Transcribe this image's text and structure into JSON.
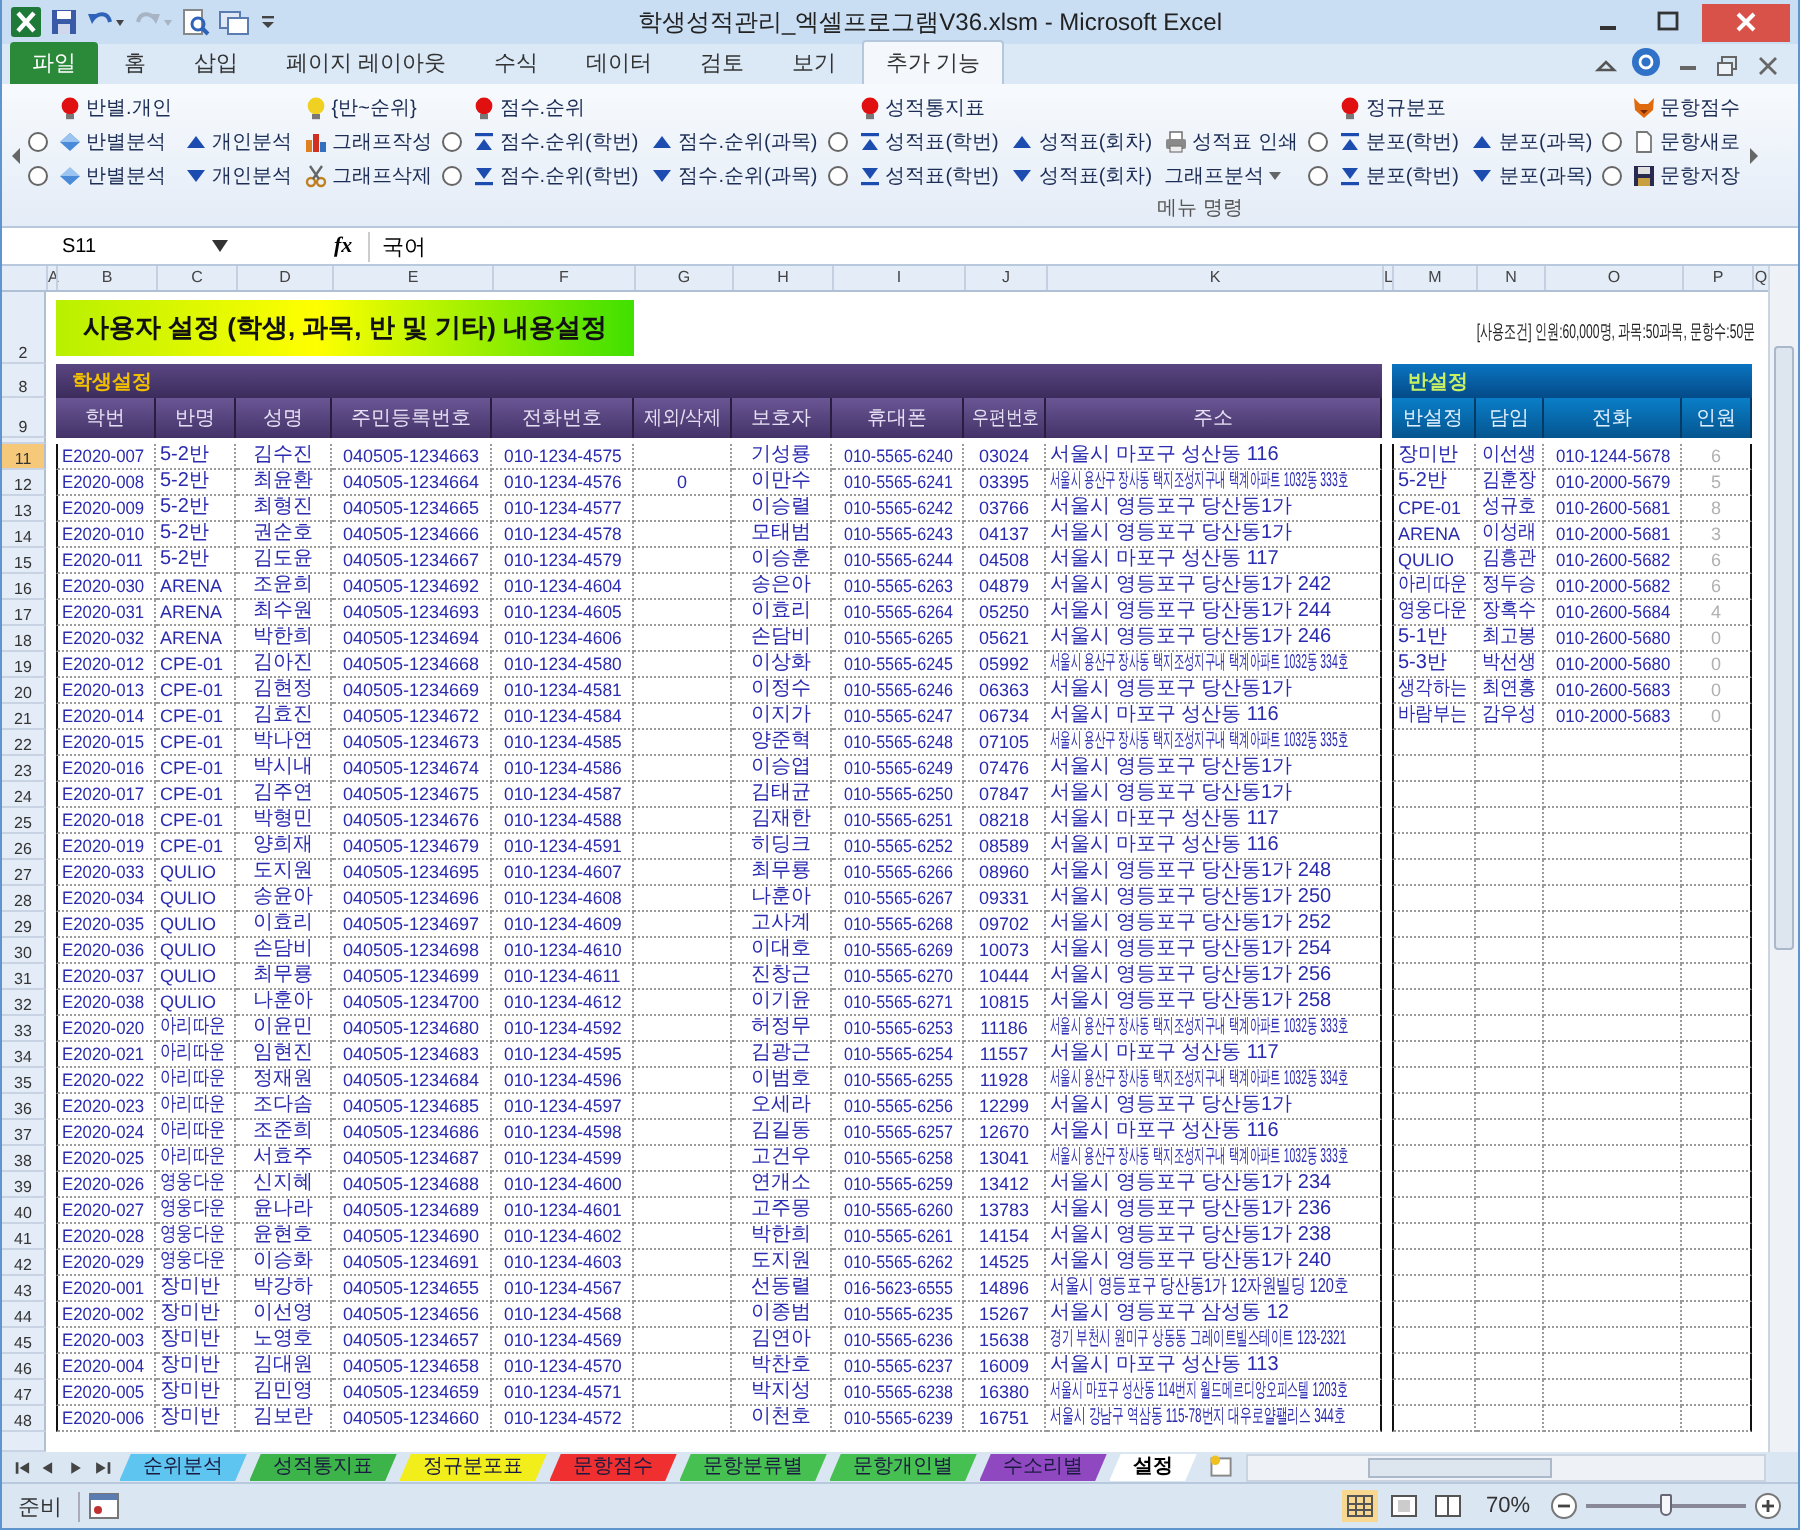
{
  "window": {
    "title": "학생성적관리_엑셀프로그램V36.xlsm  -  Microsoft Excel"
  },
  "menu_tabs": [
    {
      "label": "파일",
      "kind": "file",
      "selected": false
    },
    {
      "label": "홈",
      "selected": false
    },
    {
      "label": "삽입",
      "selected": false
    },
    {
      "label": "페이지 레이아웃",
      "selected": false
    },
    {
      "label": "수식",
      "selected": false
    },
    {
      "label": "데이터",
      "selected": false
    },
    {
      "label": "검토",
      "selected": false
    },
    {
      "label": "보기",
      "selected": false
    },
    {
      "label": "추가 기능",
      "selected": true
    }
  ],
  "ribbon": {
    "columns": [
      {
        "items": [
          {
            "kind": "radio",
            "checked": false
          },
          {
            "kind": "radio",
            "checked": false
          }
        ]
      },
      {
        "header": {
          "label": "반별.개인",
          "kind": "bulb-red"
        },
        "items": [
          {
            "label": "반별분석",
            "kind": "diamond-up"
          },
          {
            "label": "반별분석",
            "kind": "diamond-down"
          }
        ]
      },
      {
        "items": [
          {
            "label": "개인분석",
            "kind": "up"
          },
          {
            "label": "개인분석",
            "kind": "down"
          }
        ]
      },
      {
        "header": {
          "label": "{반~순위}",
          "kind": "bulb-yellow"
        },
        "items": [
          {
            "label": "그래프작성",
            "kind": "chart"
          },
          {
            "label": "그래프삭제",
            "kind": "scissors"
          }
        ]
      },
      {
        "items": [
          {
            "kind": "radio",
            "checked": false
          },
          {
            "kind": "radio",
            "checked": false
          }
        ]
      },
      {
        "header": {
          "label": "점수.순위",
          "kind": "bulb-red"
        },
        "items": [
          {
            "label": "점수.순위(학번)",
            "kind": "top"
          },
          {
            "label": "점수.순위(학번)",
            "kind": "bottom"
          }
        ]
      },
      {
        "items": [
          {
            "label": "점수.순위(과목)",
            "kind": "up"
          },
          {
            "label": "점수.순위(과목)",
            "kind": "down"
          }
        ]
      },
      {
        "items": [
          {
            "kind": "radio",
            "checked": false
          },
          {
            "kind": "radio",
            "checked": false
          }
        ]
      },
      {
        "header": {
          "label": "성적통지표",
          "kind": "bulb-red"
        },
        "items": [
          {
            "label": "성적표(학번)",
            "kind": "top"
          },
          {
            "label": "성적표(학번)",
            "kind": "bottom"
          }
        ]
      },
      {
        "items": [
          {
            "label": "성적표(회차)",
            "kind": "up"
          },
          {
            "label": "성적표(회차)",
            "kind": "down"
          }
        ]
      },
      {
        "items": [
          {
            "label": "성적표 인쇄",
            "kind": "printer"
          },
          {
            "label": "그래프분석",
            "kind": "dropdown"
          }
        ]
      },
      {
        "items": [
          {
            "kind": "radio",
            "checked": false
          },
          {
            "kind": "radio",
            "checked": false
          }
        ]
      },
      {
        "header": {
          "label": "정규분포",
          "kind": "bulb-red"
        },
        "items": [
          {
            "label": "분포(학번)",
            "kind": "top"
          },
          {
            "label": "분포(학번)",
            "kind": "bottom"
          }
        ]
      },
      {
        "items": [
          {
            "label": "분포(과목)",
            "kind": "up"
          },
          {
            "label": "분포(과목)",
            "kind": "down"
          }
        ]
      },
      {
        "items": [
          {
            "kind": "radio",
            "checked": false
          },
          {
            "kind": "radio",
            "checked": false
          }
        ]
      },
      {
        "header": {
          "label": "문항점수",
          "kind": "fox"
        },
        "items": [
          {
            "label": "문항새로",
            "kind": "doc"
          },
          {
            "label": "문항저장",
            "kind": "disk"
          }
        ]
      }
    ],
    "group_label": "메뉴 명령"
  },
  "formula_bar": {
    "name_box": "S11",
    "fx_label": "fx",
    "value": "국어"
  },
  "column_letters": [
    "A",
    "B",
    "C",
    "D",
    "E",
    "F",
    "G",
    "H",
    "I",
    "J",
    "K",
    "L",
    "M",
    "N",
    "O",
    "P",
    "Q"
  ],
  "sheet": {
    "banner_row": "2",
    "banner": "사용자 설정 (학생, 과목, 반 및 기타) 내용설정",
    "note": "[사용조건] 인원:60,000명, 과목:50과목, 문항수:50문",
    "section_row": "8",
    "student_section": "학생설정",
    "class_section": "반설정",
    "header_row": "9",
    "student_columns": [
      "학번",
      "반명",
      "성명",
      "주민등록번호",
      "전화번호",
      "제외/삭제",
      "보호자",
      "휴대폰",
      "우편번호",
      "주소"
    ],
    "class_columns": [
      "반설정",
      "담임",
      "전화",
      "인원"
    ],
    "rows": [
      {
        "num": "11",
        "selected": true,
        "student": {
          "id": "E2020-007",
          "cls": "5-2반",
          "name": "김수진",
          "rrn": "040505-1234663",
          "phone": "010-1234-4575",
          "guardian": "기성룡",
          "mobile": "010-5565-6240",
          "zip": "03024",
          "addr": "서울시 마포구 성산동 116"
        },
        "class_info": {
          "cls": "장미반",
          "teacher": "이선생",
          "phone": "010-1244-5678",
          "count": "6"
        }
      },
      {
        "num": "12",
        "selected": false,
        "student": {
          "id": "E2020-008",
          "cls": "5-2반",
          "name": "최윤환",
          "rrn": "040505-1234664",
          "phone": "010-1234-4576",
          "excl": "0",
          "guardian": "이만수",
          "mobile": "010-5565-6241",
          "zip": "03395",
          "addr": "서울시 용산구 장사동 택지조성지구내 택계아파트 1032동 333호"
        },
        "class_info": {
          "cls": "5-2반",
          "teacher": "김훈장",
          "phone": "010-2000-5679",
          "count": "5"
        }
      },
      {
        "num": "13",
        "selected": false,
        "student": {
          "id": "E2020-009",
          "cls": "5-2반",
          "name": "최형진",
          "rrn": "040505-1234665",
          "phone": "010-1234-4577",
          "guardian": "이승렬",
          "mobile": "010-5565-6242",
          "zip": "03766",
          "addr": "서울시 영등포구 당산동1가"
        },
        "class_info": {
          "cls": "CPE-01",
          "teacher": "성규호",
          "phone": "010-2600-5681",
          "count": "8"
        }
      },
      {
        "num": "14",
        "selected": false,
        "student": {
          "id": "E2020-010",
          "cls": "5-2반",
          "name": "권순호",
          "rrn": "040505-1234666",
          "phone": "010-1234-4578",
          "guardian": "모태범",
          "mobile": "010-5565-6243",
          "zip": "04137",
          "addr": "서울시 영등포구 당산동1가"
        },
        "class_info": {
          "cls": "ARENA",
          "teacher": "이성래",
          "phone": "010-2000-5681",
          "count": "3"
        }
      },
      {
        "num": "15",
        "selected": false,
        "student": {
          "id": "E2020-011",
          "cls": "5-2반",
          "name": "김도윤",
          "rrn": "040505-1234667",
          "phone": "010-1234-4579",
          "guardian": "이승훈",
          "mobile": "010-5565-6244",
          "zip": "04508",
          "addr": "서울시 마포구 성산동 117"
        },
        "class_info": {
          "cls": "QULIO",
          "teacher": "김흥관",
          "phone": "010-2600-5682",
          "count": "6"
        }
      },
      {
        "num": "16",
        "selected": false,
        "student": {
          "id": "E2020-030",
          "cls": "ARENA",
          "name": "조윤희",
          "rrn": "040505-1234692",
          "phone": "010-1234-4604",
          "guardian": "송은아",
          "mobile": "010-5565-6263",
          "zip": "04879",
          "addr": "서울시 영등포구 당산동1가 242"
        },
        "class_info": {
          "cls": "아리따운",
          "teacher": "정두승",
          "phone": "010-2000-5682",
          "count": "6"
        }
      },
      {
        "num": "17",
        "selected": false,
        "student": {
          "id": "E2020-031",
          "cls": "ARENA",
          "name": "최수원",
          "rrn": "040505-1234693",
          "phone": "010-1234-4605",
          "guardian": "이효리",
          "mobile": "010-5565-6264",
          "zip": "05250",
          "addr": "서울시 영등포구 당산동1가 244"
        },
        "class_info": {
          "cls": "영웅다운",
          "teacher": "장혹수",
          "phone": "010-2600-5684",
          "count": "4"
        }
      },
      {
        "num": "18",
        "selected": false,
        "student": {
          "id": "E2020-032",
          "cls": "ARENA",
          "name": "박한희",
          "rrn": "040505-1234694",
          "phone": "010-1234-4606",
          "guardian": "손담비",
          "mobile": "010-5565-6265",
          "zip": "05621",
          "addr": "서울시 영등포구 당산동1가 246"
        },
        "class_info": {
          "cls": "5-1반",
          "teacher": "최고봉",
          "phone": "010-2600-5680",
          "count": "0"
        }
      },
      {
        "num": "19",
        "selected": false,
        "student": {
          "id": "E2020-012",
          "cls": "CPE-01",
          "name": "김아진",
          "rrn": "040505-1234668",
          "phone": "010-1234-4580",
          "guardian": "이상화",
          "mobile": "010-5565-6245",
          "zip": "05992",
          "addr": "서울시 용산구 장사동 택지조성지구내 택계아파트 1032동 334호"
        },
        "class_info": {
          "cls": "5-3반",
          "teacher": "박선생",
          "phone": "010-2000-5680",
          "count": "0"
        }
      },
      {
        "num": "20",
        "selected": false,
        "student": {
          "id": "E2020-013",
          "cls": "CPE-01",
          "name": "김현정",
          "rrn": "040505-1234669",
          "phone": "010-1234-4581",
          "guardian": "이정수",
          "mobile": "010-5565-6246",
          "zip": "06363",
          "addr": "서울시 영등포구 당산동1가"
        },
        "class_info": {
          "cls": "생각하는",
          "teacher": "최연홍",
          "phone": "010-2600-5683",
          "count": "0"
        }
      },
      {
        "num": "21",
        "selected": false,
        "student": {
          "id": "E2020-014",
          "cls": "CPE-01",
          "name": "김효진",
          "rrn": "040505-1234672",
          "phone": "010-1234-4584",
          "guardian": "이지가",
          "mobile": "010-5565-6247",
          "zip": "06734",
          "addr": "서울시 마포구 성산동 116"
        },
        "class_info": {
          "cls": "바람부는",
          "teacher": "감우성",
          "phone": "010-2000-5683",
          "count": "0"
        }
      },
      {
        "num": "22",
        "selected": false,
        "student": {
          "id": "E2020-015",
          "cls": "CPE-01",
          "name": "박나연",
          "rrn": "040505-1234673",
          "phone": "010-1234-4585",
          "guardian": "양준혁",
          "mobile": "010-5565-6248",
          "zip": "07105",
          "addr": "서울시 용산구 장사동 택지조성지구내 택계아파트 1032동 335호"
        }
      },
      {
        "num": "23",
        "selected": false,
        "student": {
          "id": "E2020-016",
          "cls": "CPE-01",
          "name": "박시내",
          "rrn": "040505-1234674",
          "phone": "010-1234-4586",
          "guardian": "이승엽",
          "mobile": "010-5565-6249",
          "zip": "07476",
          "addr": "서울시 영등포구 당산동1가"
        }
      },
      {
        "num": "24",
        "selected": false,
        "student": {
          "id": "E2020-017",
          "cls": "CPE-01",
          "name": "김주연",
          "rrn": "040505-1234675",
          "phone": "010-1234-4587",
          "guardian": "김태균",
          "mobile": "010-5565-6250",
          "zip": "07847",
          "addr": "서울시 영등포구 당산동1가"
        }
      },
      {
        "num": "25",
        "selected": false,
        "student": {
          "id": "E2020-018",
          "cls": "CPE-01",
          "name": "박형민",
          "rrn": "040505-1234676",
          "phone": "010-1234-4588",
          "guardian": "김재한",
          "mobile": "010-5565-6251",
          "zip": "08218",
          "addr": "서울시 마포구 성산동 117"
        }
      },
      {
        "num": "26",
        "selected": false,
        "student": {
          "id": "E2020-019",
          "cls": "CPE-01",
          "name": "양희재",
          "rrn": "040505-1234679",
          "phone": "010-1234-4591",
          "guardian": "히딩크",
          "mobile": "010-5565-6252",
          "zip": "08589",
          "addr": "서울시 마포구 성산동 116"
        }
      },
      {
        "num": "27",
        "selected": false,
        "student": {
          "id": "E2020-033",
          "cls": "QULIO",
          "name": "도지원",
          "rrn": "040505-1234695",
          "phone": "010-1234-4607",
          "guardian": "최무룡",
          "mobile": "010-5565-6266",
          "zip": "08960",
          "addr": "서울시 영등포구 당산동1가 248"
        }
      },
      {
        "num": "28",
        "selected": false,
        "student": {
          "id": "E2020-034",
          "cls": "QULIO",
          "name": "송윤아",
          "rrn": "040505-1234696",
          "phone": "010-1234-4608",
          "guardian": "나훈아",
          "mobile": "010-5565-6267",
          "zip": "09331",
          "addr": "서울시 영등포구 당산동1가 250"
        }
      },
      {
        "num": "29",
        "selected": false,
        "student": {
          "id": "E2020-035",
          "cls": "QULIO",
          "name": "이효리",
          "rrn": "040505-1234697",
          "phone": "010-1234-4609",
          "guardian": "고사계",
          "mobile": "010-5565-6268",
          "zip": "09702",
          "addr": "서울시 영등포구 당산동1가 252"
        }
      },
      {
        "num": "30",
        "selected": false,
        "student": {
          "id": "E2020-036",
          "cls": "QULIO",
          "name": "손담비",
          "rrn": "040505-1234698",
          "phone": "010-1234-4610",
          "guardian": "이대호",
          "mobile": "010-5565-6269",
          "zip": "10073",
          "addr": "서울시 영등포구 당산동1가 254"
        }
      },
      {
        "num": "31",
        "selected": false,
        "student": {
          "id": "E2020-037",
          "cls": "QULIO",
          "name": "최무룡",
          "rrn": "040505-1234699",
          "phone": "010-1234-4611",
          "guardian": "진창근",
          "mobile": "010-5565-6270",
          "zip": "10444",
          "addr": "서울시 영등포구 당산동1가 256"
        }
      },
      {
        "num": "32",
        "selected": false,
        "student": {
          "id": "E2020-038",
          "cls": "QULIO",
          "name": "나훈아",
          "rrn": "040505-1234700",
          "phone": "010-1234-4612",
          "guardian": "이기윤",
          "mobile": "010-5565-6271",
          "zip": "10815",
          "addr": "서울시 영등포구 당산동1가 258"
        }
      },
      {
        "num": "33",
        "selected": false,
        "student": {
          "id": "E2020-020",
          "cls": "아리따운",
          "name": "이윤민",
          "rrn": "040505-1234680",
          "phone": "010-1234-4592",
          "guardian": "허정무",
          "mobile": "010-5565-6253",
          "zip": "11186",
          "addr": "서울시 용산구 장사동 택지조성지구내 택계아파트 1032동 333호"
        }
      },
      {
        "num": "34",
        "selected": false,
        "student": {
          "id": "E2020-021",
          "cls": "아리따운",
          "name": "임현진",
          "rrn": "040505-1234683",
          "phone": "010-1234-4595",
          "guardian": "김광근",
          "mobile": "010-5565-6254",
          "zip": "11557",
          "addr": "서울시 마포구 성산동 117"
        }
      },
      {
        "num": "35",
        "selected": false,
        "student": {
          "id": "E2020-022",
          "cls": "아리따운",
          "name": "정재원",
          "rrn": "040505-1234684",
          "phone": "010-1234-4596",
          "guardian": "이범호",
          "mobile": "010-5565-6255",
          "zip": "11928",
          "addr": "서울시 용산구 장사동 택지조성지구내 택계아파트 1032동 334호"
        }
      },
      {
        "num": "36",
        "selected": false,
        "student": {
          "id": "E2020-023",
          "cls": "아리따운",
          "name": "조다솜",
          "rrn": "040505-1234685",
          "phone": "010-1234-4597",
          "guardian": "오세라",
          "mobile": "010-5565-6256",
          "zip": "12299",
          "addr": "서울시 영등포구 당산동1가"
        }
      },
      {
        "num": "37",
        "selected": false,
        "student": {
          "id": "E2020-024",
          "cls": "아리따운",
          "name": "조준희",
          "rrn": "040505-1234686",
          "phone": "010-1234-4598",
          "guardian": "김길동",
          "mobile": "010-5565-6257",
          "zip": "12670",
          "addr": "서울시 마포구 성산동 116"
        }
      },
      {
        "num": "38",
        "selected": false,
        "student": {
          "id": "E2020-025",
          "cls": "아리따운",
          "name": "서효주",
          "rrn": "040505-1234687",
          "phone": "010-1234-4599",
          "guardian": "고건우",
          "mobile": "010-5565-6258",
          "zip": "13041",
          "addr": "서울시 용산구 장사동 택지조성지구내 택계아파트 1032동 333호"
        }
      },
      {
        "num": "39",
        "selected": false,
        "student": {
          "id": "E2020-026",
          "cls": "영웅다운",
          "name": "신지혜",
          "rrn": "040505-1234688",
          "phone": "010-1234-4600",
          "guardian": "연개소",
          "mobile": "010-5565-6259",
          "zip": "13412",
          "addr": "서울시 영등포구 당산동1가 234"
        }
      },
      {
        "num": "40",
        "selected": false,
        "student": {
          "id": "E2020-027",
          "cls": "영웅다운",
          "name": "윤나라",
          "rrn": "040505-1234689",
          "phone": "010-1234-4601",
          "guardian": "고주몽",
          "mobile": "010-5565-6260",
          "zip": "13783",
          "addr": "서울시 영등포구 당산동1가 236"
        }
      },
      {
        "num": "41",
        "selected": false,
        "student": {
          "id": "E2020-028",
          "cls": "영웅다운",
          "name": "윤현호",
          "rrn": "040505-1234690",
          "phone": "010-1234-4602",
          "guardian": "박한희",
          "mobile": "010-5565-6261",
          "zip": "14154",
          "addr": "서울시 영등포구 당산동1가 238"
        }
      },
      {
        "num": "42",
        "selected": false,
        "student": {
          "id": "E2020-029",
          "cls": "영웅다운",
          "name": "이승화",
          "rrn": "040505-1234691",
          "phone": "010-1234-4603",
          "guardian": "도지원",
          "mobile": "010-5565-6262",
          "zip": "14525",
          "addr": "서울시 영등포구 당산동1가 240"
        }
      },
      {
        "num": "43",
        "selected": false,
        "student": {
          "id": "E2020-001",
          "cls": "장미반",
          "name": "박강하",
          "rrn": "040505-1234655",
          "phone": "010-1234-4567",
          "guardian": "선동렬",
          "mobile": "016-5623-6555",
          "zip": "14896",
          "addr": "서울시 영등포구 당산동1가 12자원빌딩 120호"
        }
      },
      {
        "num": "44",
        "selected": false,
        "student": {
          "id": "E2020-002",
          "cls": "장미반",
          "name": "이선영",
          "rrn": "040505-1234656",
          "phone": "010-1234-4568",
          "guardian": "이종범",
          "mobile": "010-5565-6235",
          "zip": "15267",
          "addr": "서울시 영등포구 삼성동 12"
        }
      },
      {
        "num": "45",
        "selected": false,
        "student": {
          "id": "E2020-003",
          "cls": "장미반",
          "name": "노영호",
          "rrn": "040505-1234657",
          "phone": "010-1234-4569",
          "guardian": "김연아",
          "mobile": "010-5565-6236",
          "zip": "15638",
          "addr": "경기 부천시 원미구 상동동 그레이트빌스테이트 123-2321"
        }
      },
      {
        "num": "46",
        "selected": false,
        "student": {
          "id": "E2020-004",
          "cls": "장미반",
          "name": "김대원",
          "rrn": "040505-1234658",
          "phone": "010-1234-4570",
          "guardian": "박찬호",
          "mobile": "010-5565-6237",
          "zip": "16009",
          "addr": "서울시 마포구 성산동 113"
        }
      },
      {
        "num": "47",
        "selected": false,
        "student": {
          "id": "E2020-005",
          "cls": "장미반",
          "name": "김민영",
          "rrn": "040505-1234659",
          "phone": "010-1234-4571",
          "guardian": "박지성",
          "mobile": "010-5565-6238",
          "zip": "16380",
          "addr": "서울시 마포구 성산동 114번지 월드메르디앙오피스텔 1203호"
        }
      },
      {
        "num": "48",
        "selected": false,
        "student": {
          "id": "E2020-006",
          "cls": "장미반",
          "name": "김보란",
          "rrn": "040505-1234660",
          "phone": "010-1234-4572",
          "guardian": "이천호",
          "mobile": "010-5565-6239",
          "zip": "16751",
          "addr": "서울시 강남구 역삼동 115-78번지 대우로얄팰리스 344호"
        }
      }
    ]
  },
  "sheet_tabs": [
    {
      "label": "순위분석",
      "color": "#5ec4f0",
      "selected": false
    },
    {
      "label": "성적통지표",
      "color": "#3cb44a",
      "selected": false
    },
    {
      "label": "정규분포표",
      "color": "#f2ee1c",
      "selected": false
    },
    {
      "label": "문항점수",
      "color": "#f03030",
      "selected": false
    },
    {
      "label": "문항분류별",
      "color": "#46c050",
      "selected": false
    },
    {
      "label": "문항개인별",
      "color": "#46c050",
      "selected": false
    },
    {
      "label": "수소리별",
      "color": "#9048c0",
      "selected": false
    },
    {
      "label": "설정",
      "selected": true
    }
  ],
  "status_bar": {
    "text": "준비",
    "zoom": "70%",
    "zoom_slider": {
      "level": 0.5
    }
  }
}
